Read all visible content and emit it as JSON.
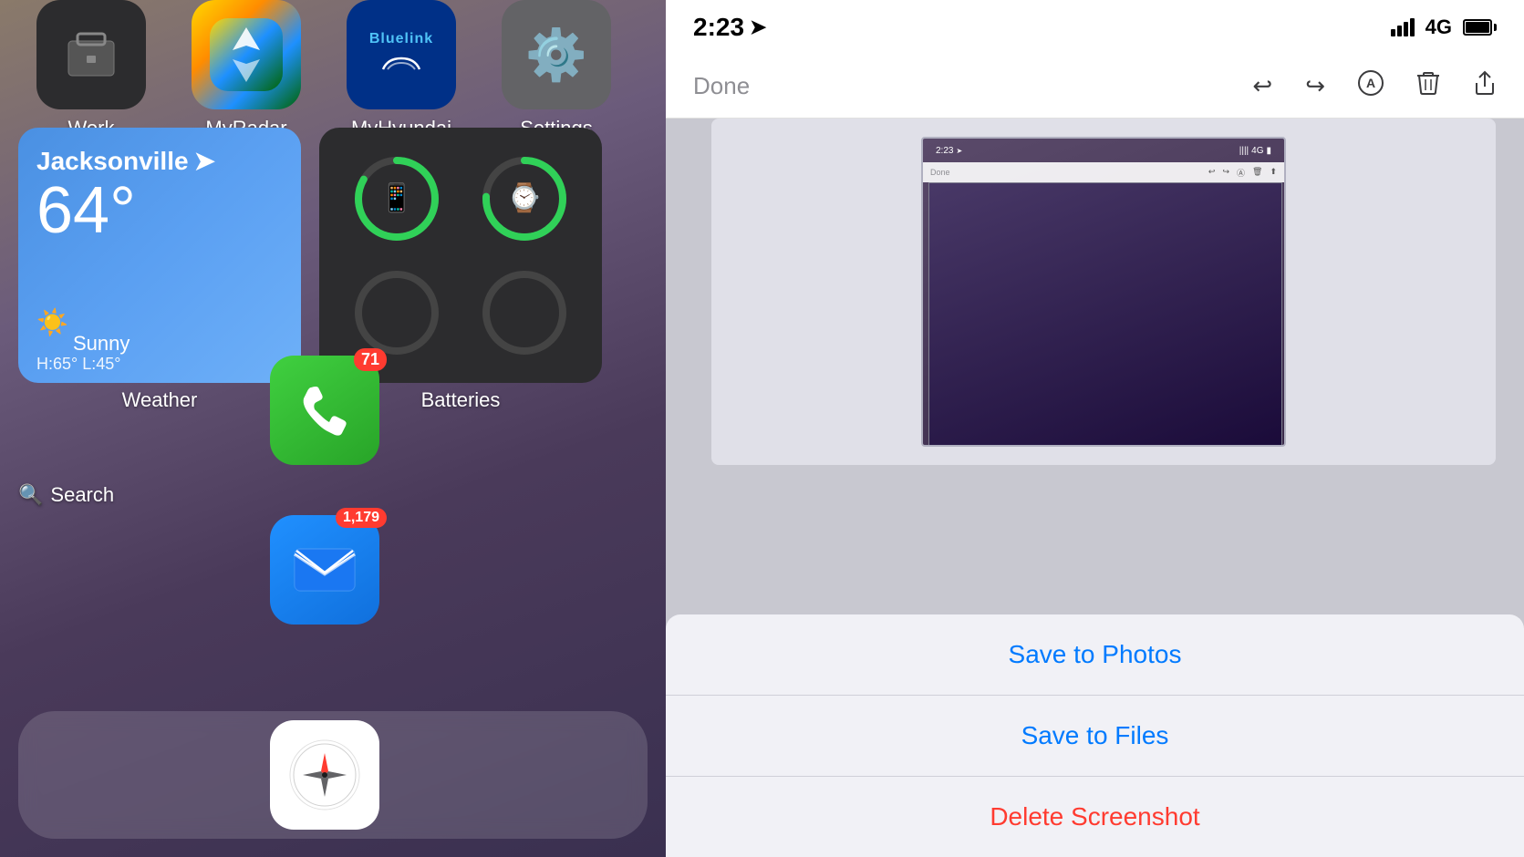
{
  "left": {
    "apps_top": [
      {
        "label": "Work",
        "icon_type": "work"
      },
      {
        "label": "MyRadar",
        "icon_type": "myradar"
      },
      {
        "label": "MyHyundai",
        "icon_type": "bluelink"
      },
      {
        "label": "Settings",
        "icon_type": "settings"
      }
    ],
    "weather": {
      "city": "Jacksonville",
      "temp": "64°",
      "condition": "Sunny",
      "high_low": "H:65°  L:45°",
      "label": "Weather"
    },
    "batteries": {
      "label": "Batteries"
    },
    "phone": {
      "badge": "71"
    },
    "search": {
      "text": "Search"
    },
    "mail": {
      "badge": "1,179"
    }
  },
  "right": {
    "status": {
      "time": "2:23",
      "network": "4G"
    },
    "toolbar": {
      "done_label": "Done"
    },
    "preview_status": {
      "time": "2:23",
      "network": "4G"
    },
    "preview_toolbar": {
      "done_label": "Done"
    },
    "action_sheet": {
      "items": [
        {
          "label": "Save to Photos",
          "color": "blue"
        },
        {
          "label": "Save to Files",
          "color": "blue"
        },
        {
          "label": "Delete Screenshot",
          "color": "red"
        }
      ]
    }
  }
}
